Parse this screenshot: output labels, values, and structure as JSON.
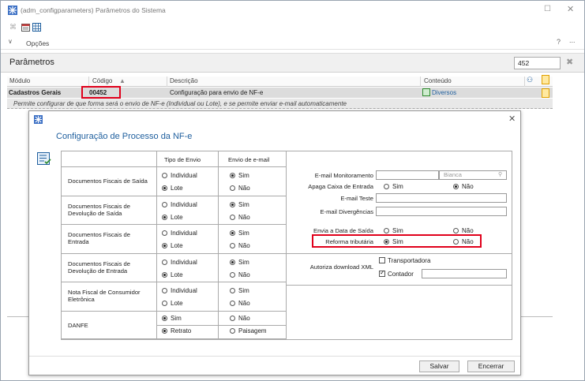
{
  "window": {
    "title": "(adm_configparameters) Parâmetros do Sistema",
    "options_label": "Opções",
    "help_label": "?",
    "more_label": "..."
  },
  "params": {
    "title": "Parâmetros",
    "search_value": "452"
  },
  "grid": {
    "columns": [
      "Módulo",
      "Código",
      "Descrição",
      "Conteúdo"
    ],
    "row": {
      "modulo": "Cadastros Gerais",
      "codigo": "00452",
      "descricao": "Configuração para envio de NF-e",
      "conteudo": "Diversos"
    },
    "row_description": "Permite configurar de que forma será o envio de NF-e (Individual ou Lote), e se permite enviar e-mail automaticamente"
  },
  "dialog": {
    "title": "Configuração de Processo da NF-e",
    "col_tipo_envio": "Tipo de Envio",
    "col_envio_email": "Envio de e-mail",
    "rows": [
      {
        "label": "Documentos Fiscais de Saída",
        "opt1": "Individual",
        "opt2": "Lote",
        "sel1": "opt2",
        "e1": "Sim",
        "e2": "Não",
        "esel": "e1"
      },
      {
        "label": "Documentos Fiscais de Devolução de Saída",
        "opt1": "Individual",
        "opt2": "Lote",
        "sel1": "opt2",
        "e1": "Sim",
        "e2": "Não",
        "esel": "e1"
      },
      {
        "label": "Documentos Fiscais de Entrada",
        "opt1": "Individual",
        "opt2": "Lote",
        "sel1": "opt2",
        "e1": "Sim",
        "e2": "Não",
        "esel": "e1"
      },
      {
        "label": "Documentos Fiscais de Devolução de Entrada",
        "opt1": "Individual",
        "opt2": "Lote",
        "sel1": "opt2",
        "e1": "Sim",
        "e2": "Não",
        "esel": "e1"
      },
      {
        "label": "Nota Fiscal de Consumidor Eletrônica",
        "opt1": "Individual",
        "opt2": "Lote",
        "sel1": "",
        "e1": "Sim",
        "e2": "Não",
        "esel": ""
      },
      {
        "label": "DANFE",
        "opt1": "Sim",
        "opt2": "Retrato",
        "sel1": "both",
        "e1": "Não",
        "e2": "Paisagem",
        "esel": ""
      }
    ],
    "right": {
      "email_monitoramento": "E-mail Monitoramento",
      "email_monitoramento_value": "Bianca",
      "apaga_caixa": "Apaga Caixa de Entrada",
      "email_teste": "E-mail Teste",
      "email_divergencias": "E-mail Divergências",
      "envia_data_saida": "Envia a Data de Saída",
      "reforma_tributaria": "Reforma tributária",
      "autoriza_download": "Autoriza download XML",
      "transportadora": "Transportadora",
      "contador": "Contador",
      "sim": "Sim",
      "nao": "Não"
    },
    "salvar": "Salvar",
    "encerrar": "Encerrar"
  }
}
